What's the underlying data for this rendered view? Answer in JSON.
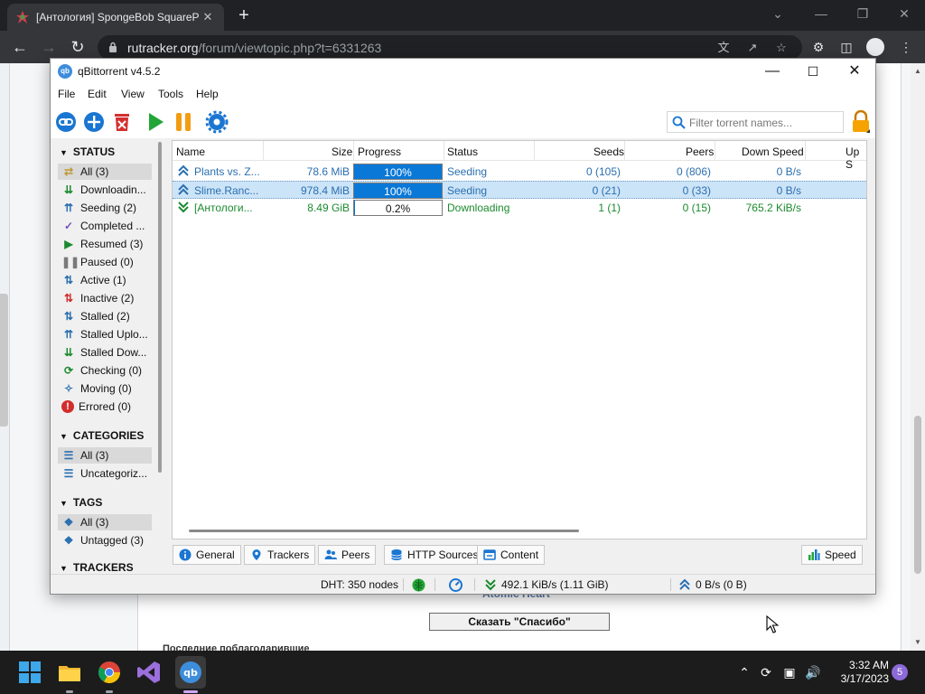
{
  "browser": {
    "tab_title": "[Антология] SpongeBob SquareP",
    "tab_close": "✕",
    "new_tab": "+",
    "url_host": "rutracker.org",
    "url_path": "/forum/viewtopic.php?t=6331263",
    "win_min": "⌄",
    "win_minimize": "—",
    "win_restore": "❐",
    "win_close": "✕"
  },
  "webpage": {
    "thanks_button": "Сказать \"Спасибо\"",
    "behind_title": "Atomic Heart",
    "bottom_text": "Последние поблагодарившие"
  },
  "qbittorrent": {
    "title": "qBittorrent v4.5.2",
    "app_icon_text": "qb",
    "menu": [
      "File",
      "Edit",
      "View",
      "Tools",
      "Help"
    ],
    "filter_placeholder": "Filter torrent names...",
    "sidebar": {
      "status_header": "STATUS",
      "status_items": [
        {
          "label": "All (3)",
          "icon": "swap-icon",
          "color": "#c09a3a",
          "selected": true
        },
        {
          "label": "Downloadin...",
          "icon": "download-icon",
          "color": "#1b8a2e"
        },
        {
          "label": "Seeding (2)",
          "icon": "upload-icon",
          "color": "#2a6fb0"
        },
        {
          "label": "Completed ...",
          "icon": "check-icon",
          "color": "#7a4db8"
        },
        {
          "label": "Resumed (3)",
          "icon": "play-icon",
          "color": "#1b8a2e"
        },
        {
          "label": "Paused (0)",
          "icon": "pause-icon",
          "color": "#7a7a7a"
        },
        {
          "label": "Active (1)",
          "icon": "active-arrows-icon",
          "color": "#2a6fb0"
        },
        {
          "label": "Inactive (2)",
          "icon": "inactive-arrows-icon",
          "color": "#d12e2e"
        },
        {
          "label": "Stalled (2)",
          "icon": "stalled-arrows-icon",
          "color": "#2a6fb0"
        },
        {
          "label": "Stalled Uplo...",
          "icon": "stalled-upload-icon",
          "color": "#2a6fb0"
        },
        {
          "label": "Stalled Dow...",
          "icon": "stalled-download-icon",
          "color": "#1b8a2e"
        },
        {
          "label": "Checking (0)",
          "icon": "refresh-icon",
          "color": "#1b8a2e"
        },
        {
          "label": "Moving (0)",
          "icon": "move-icon",
          "color": "#2a6fb0"
        },
        {
          "label": "Errored (0)",
          "icon": "error-icon",
          "color": "#d12e2e"
        }
      ],
      "categories_header": "CATEGORIES",
      "categories_items": [
        {
          "label": "All (3)",
          "selected": true
        },
        {
          "label": "Uncategoriz..."
        }
      ],
      "tags_header": "TAGS",
      "tags_items": [
        {
          "label": "All (3)",
          "selected": true
        },
        {
          "label": "Untagged (3)"
        }
      ],
      "trackers_header": "TRACKERS"
    },
    "columns": [
      "Name",
      "Size",
      "Progress",
      "Status",
      "Seeds",
      "Peers",
      "Down Speed",
      "Up S"
    ],
    "torrents": [
      {
        "name": "Plants vs. Z...",
        "size": "78.6 MiB",
        "progress": 100,
        "progress_text": "100%",
        "status": "Seeding",
        "seeds": "0 (105)",
        "peers": "0 (806)",
        "down": "0 B/s",
        "state": "seeding"
      },
      {
        "name": "Slime.Ranc...",
        "size": "978.4 MiB",
        "progress": 100,
        "progress_text": "100%",
        "status": "Seeding",
        "seeds": "0 (21)",
        "peers": "0 (33)",
        "down": "0 B/s",
        "state": "seeding",
        "selected": true
      },
      {
        "name": "[Антологи...",
        "size": "8.49 GiB",
        "progress": 0.2,
        "progress_text": "0.2%",
        "status": "Downloading",
        "seeds": "1 (1)",
        "peers": "0 (15)",
        "down": "765.2 KiB/s",
        "state": "downloading"
      }
    ],
    "bottom_tabs": [
      "General",
      "Trackers",
      "Peers",
      "HTTP Sources",
      "Content"
    ],
    "speed_tab": "Speed",
    "statusbar": {
      "dht": "DHT: 350 nodes",
      "download": "492.1 KiB/s (1.11 GiB)",
      "upload": "0 B/s (0 B)"
    }
  },
  "taskbar": {
    "time": "3:32 AM",
    "date": "3/17/2023",
    "notifications": "5"
  },
  "colors": {
    "accent": "#0a78d7",
    "seeding": "#2a6fb0",
    "downloading": "#1b8a2e"
  }
}
